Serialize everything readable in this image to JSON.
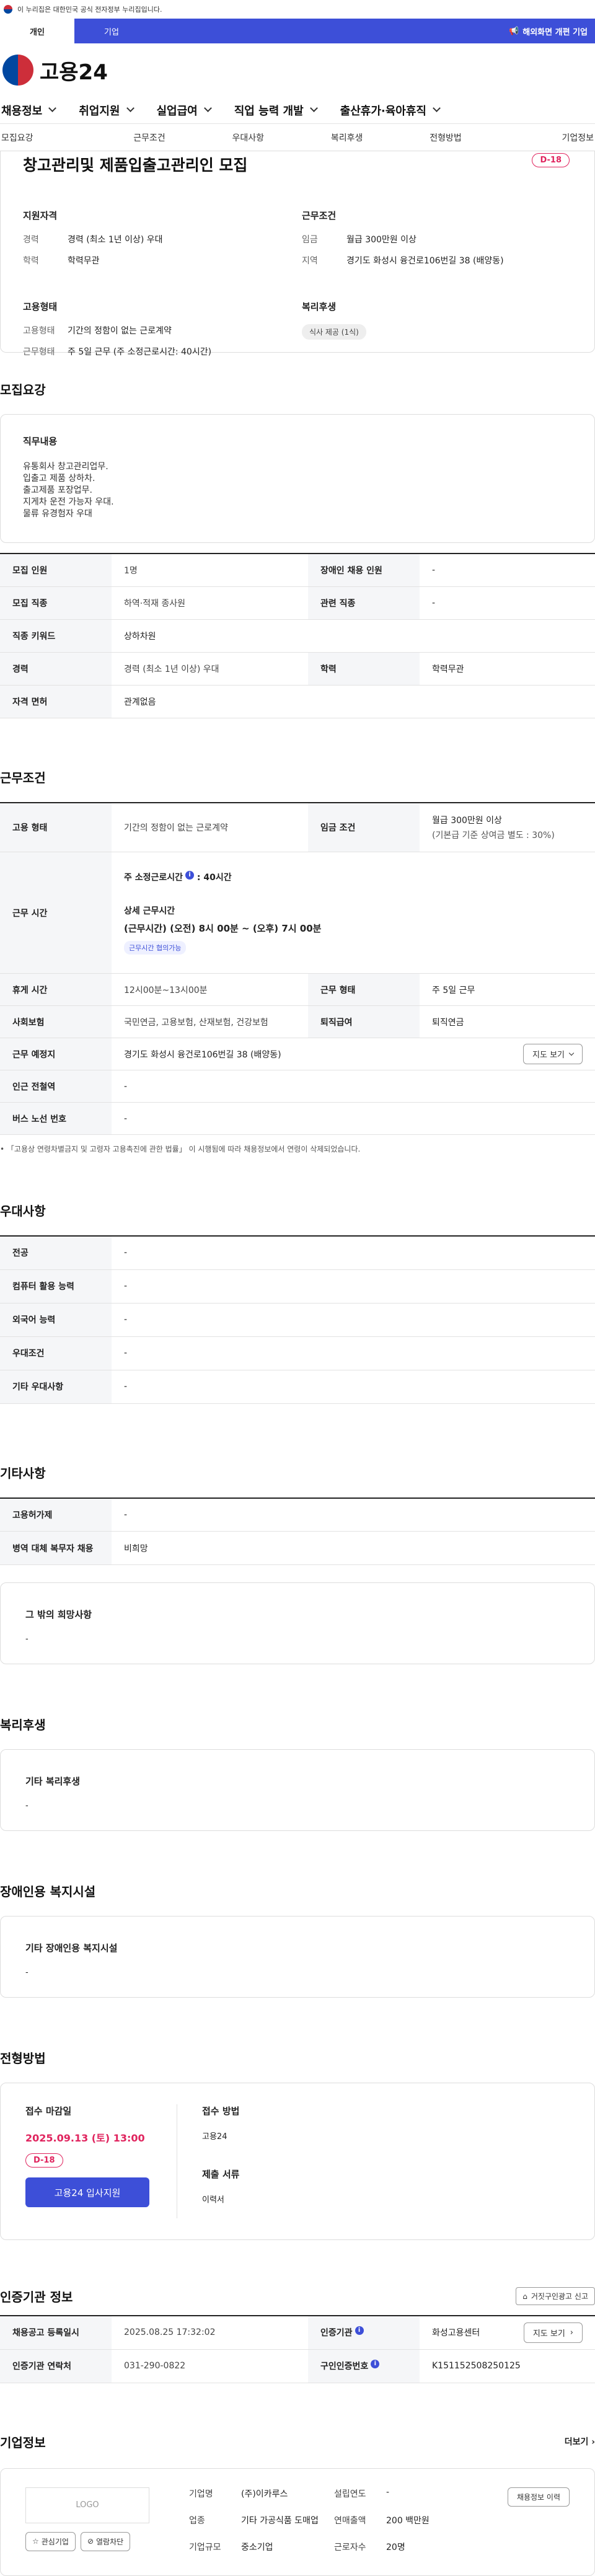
{
  "gov_banner": {
    "text": "이 누리집은 대한민국 공식 전자정부 누리집입니다."
  },
  "top_tabs": [
    {
      "label": "개인"
    },
    {
      "label": "기업"
    }
  ],
  "top_right": {
    "label": "해외화면 개편 기업"
  },
  "logo": {
    "text": "고용24"
  },
  "gnb": [
    {
      "label": "채용정보"
    },
    {
      "label": "취업지원"
    },
    {
      "label": "실업급여"
    },
    {
      "label": "직업 능력 개발"
    },
    {
      "label": "출산휴가·육아휴직"
    }
  ],
  "anchors": [
    {
      "label": "모집요강"
    },
    {
      "label": "근무조건"
    },
    {
      "label": "우대사항"
    },
    {
      "label": "복리후생"
    },
    {
      "label": "전형방법"
    },
    {
      "label": "기업정보"
    }
  ],
  "summary": {
    "title": "창고관리및 제품입출고관리인 모집",
    "dday": "D-18",
    "qual_title": "지원자격",
    "qual": [
      {
        "label": "경력",
        "value": "경력 (최소 1년 이상) 우대"
      },
      {
        "label": "학력",
        "value": "학력무관"
      }
    ],
    "cond_title": "근무조건",
    "cond": [
      {
        "label": "임금",
        "value": "월급 300만원 이상"
      },
      {
        "label": "지역",
        "value": "경기도 화성시 융건로106번길 38 (배양동)"
      }
    ],
    "emp_title": "고용형태",
    "emp": [
      {
        "label": "고용형태",
        "value": "기간의 정함이 없는 근로계약"
      },
      {
        "label": "근무형태",
        "value": "주 5일 근무 (주 소정근로시간: 40시간)"
      }
    ],
    "welfare_title": "복리후생",
    "welfare_pill": "식사 제공 (1식)"
  },
  "recruit": {
    "title": "모집요강",
    "duty_title": "직무내용",
    "duty_lines": [
      "유통회사 창고관리업무.",
      "입출고 제품 상하차.",
      "출고제품 포장업무.",
      "지게차 운전 가능자 우대.",
      "물류 유경험자 우대"
    ],
    "rows": [
      [
        "모집 인원",
        "1명",
        "장애인 채용 인원",
        "-"
      ],
      [
        "모집 직종",
        "하역·적재 종사원",
        "관련 직종",
        "-"
      ],
      [
        "직종 키워드",
        "상하차원"
      ],
      [
        "경력",
        "경력 (최소 1년 이상) 우대",
        "학력",
        "학력무관"
      ],
      [
        "자격 면허",
        "관계없음"
      ]
    ]
  },
  "work": {
    "title": "근무조건",
    "employment_label": "고용 형태",
    "employment_value": "기간의 정함이 없는 근로계약",
    "wage_label": "임금 조건",
    "wage_value": "월급 300만원 이상",
    "wage_note": "(기본급 기준 상여금 별도 : 30%)",
    "hours_label": "근무 시간",
    "weekly_hours_label": "주 소정근로시간",
    "weekly_hours_value": "40시간",
    "detail_label": "상세 근무시간",
    "detail_value": "(근무시간) (오전) 8시 00분 ~ (오후) 7시 00분",
    "tag": "근무시간 협의가능",
    "rest_label": "휴게 시간",
    "rest_value": "12시00분~13시00분",
    "form_label": "근무 형태",
    "form_value": "주 5일 근무",
    "insurance_label": "사회보험",
    "insurance_value": "국민연금, 고용보험, 산재보험, 건강보험",
    "retire_label": "퇴직급여",
    "retire_value": "퇴직연금",
    "place_label": "근무 예정지",
    "place_value": "경기도 화성시 융건로106번길 38 (배양동)",
    "map_button": "지도 보기",
    "station_label": "인근 전철역",
    "station_value": "-",
    "bus_label": "버스 노선 번호",
    "bus_value": "-",
    "note": "「고용상 연령차별금지 및 고령자 고용촉진에 관한 법률」 이 시행됨에 따라 채용정보에서 연령이 삭제되었습니다."
  },
  "pref": {
    "title": "우대사항",
    "rows": [
      [
        "전공",
        "-"
      ],
      [
        "컴퓨터 활용 능력",
        "-"
      ],
      [
        "외국어 능력",
        "-"
      ],
      [
        "우대조건",
        "-"
      ],
      [
        "기타 우대사항",
        "-"
      ]
    ]
  },
  "etc": {
    "title": "기타사항",
    "rows": [
      [
        "고용허가제",
        "-"
      ],
      [
        "병역 대체 복무자 채용",
        "비희망"
      ]
    ],
    "wish_title": "그 밖의 희망사항",
    "wish_value": "-"
  },
  "welfare": {
    "title": "복리후생",
    "box_title": "기타 복리후생",
    "box_value": "-"
  },
  "disabled": {
    "title": "장애인용 복지시설",
    "box_title": "기타 장애인용 복지시설",
    "box_value": "-"
  },
  "apply": {
    "title": "전형방법",
    "deadline_title": "접수 마감일",
    "deadline": "2025.09.13 (토) 13:00",
    "dday": "D-18",
    "button": "고용24 입사지원",
    "method_title": "접수 방법",
    "method_value": "고용24",
    "docs_title": "제출 서류",
    "docs_value": "이력서"
  },
  "cert": {
    "title": "인증기관 정보",
    "report_button": "거짓구인광고 신고",
    "rows": [
      [
        "채용공고 등록일시",
        "2025.08.25 17:32:02",
        "인증기관",
        "화성고용센터"
      ],
      [
        "인증기관 연락처",
        "031-290-0822",
        "구인인증번호",
        "K151152508250125"
      ]
    ],
    "map_button": "지도 보기"
  },
  "company": {
    "title": "기업정보",
    "more": "더보기",
    "logo_text": "LOGO",
    "btn_like": "관심기업",
    "btn_block": "열람차단",
    "history_button": "채용정보 이력",
    "fields": [
      {
        "k": "기업명",
        "v": "(주)이카루스"
      },
      {
        "k": "설립연도",
        "v": "-"
      },
      {
        "k": "업종",
        "v": "기타 가공식품 도매업"
      },
      {
        "k": "연매출액",
        "v": "200 백만원"
      },
      {
        "k": "기업규모",
        "v": "중소기업"
      },
      {
        "k": "근로자수",
        "v": "20명"
      }
    ]
  },
  "colors": {
    "primary": "#3d4fd8",
    "dday": "#e0245e"
  }
}
